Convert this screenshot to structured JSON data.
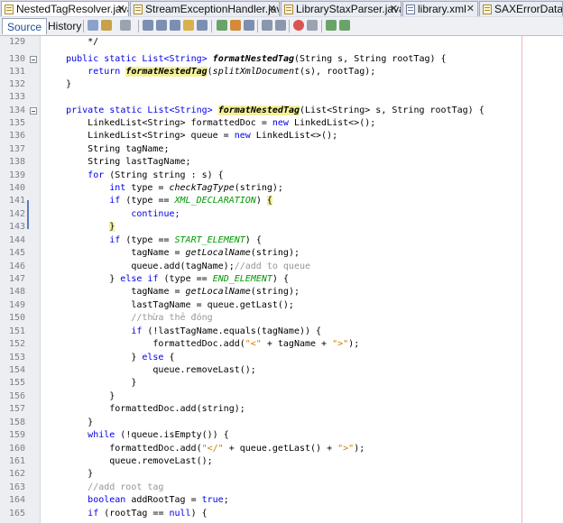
{
  "tabs": [
    {
      "label": "NestedTagResolver.java",
      "active": true
    },
    {
      "label": "StreamExceptionHandler.java",
      "active": false
    },
    {
      "label": "LibraryStaxParser.java",
      "active": false
    },
    {
      "label": "library.xml",
      "active": false
    },
    {
      "label": "SAXErrorDataPars",
      "active": false
    }
  ],
  "view_tabs": {
    "source": "Source",
    "history": "History"
  },
  "gutter": {
    "line_numbers": [
      "129",
      "130",
      "131",
      "132",
      "133",
      "134",
      "135",
      "136",
      "137",
      "138",
      "139",
      "140",
      "141",
      "142",
      "143",
      "144",
      "145",
      "146",
      "147",
      "148",
      "149",
      "150",
      "151",
      "152",
      "153",
      "154",
      "155",
      "156",
      "157",
      "158",
      "159",
      "160",
      "161",
      "162",
      "163",
      "164",
      "165"
    ]
  },
  "code": {
    "l129": "        */",
    "l130a": "    public static List<String> ",
    "l130m": "formatNestedTag",
    "l130b": "(String s, String rootTag) {",
    "l131a": "        return ",
    "l131m": "formatNestedTag",
    "l131b": "(",
    "l131c": "splitXmlDocument",
    "l131d": "(s), rootTag);",
    "l132": "    }",
    "l133": "",
    "l134a": "    private static List<String> ",
    "l134m": "formatNestedTag",
    "l134b": "(List<String> s, String rootTag) {",
    "l135": "        LinkedList<String> formattedDoc = new LinkedList<>();",
    "l136": "        LinkedList<String> queue = new LinkedList<>();",
    "l137": "        String tagName;",
    "l138": "        String lastTagName;",
    "l139": "        for (String string : s) {",
    "l140a": "            int type = ",
    "l140m": "checkTagType",
    "l140b": "(string);",
    "l141a": "            if (type == ",
    "l141c": "XML_DECLARATION",
    "l141b": ") ",
    "l141br": "{",
    "l142": "                continue;",
    "l143a": "            ",
    "l143br": "}",
    "l144a": "            if (type == ",
    "l144c": "START_ELEMENT",
    "l144b": ") {",
    "l145a": "                tagName = ",
    "l145m": "getLocalName",
    "l145b": "(string);",
    "l146a": "                queue.add(tagName);",
    "l146c": "//add to queue",
    "l147a": "            } else if (type == ",
    "l147c": "END_ELEMENT",
    "l147b": ") {",
    "l148a": "                tagName = ",
    "l148m": "getLocalName",
    "l148b": "(string);",
    "l149": "                lastTagName = queue.getLast();",
    "l150": "                //thừa thẻ đóng",
    "l151": "                if (!lastTagName.equals(tagName)) {",
    "l152a": "                    formattedDoc.add(",
    "l152s1": "\"<\"",
    "l152b": " + tagName + ",
    "l152s2": "\">\"",
    "l152c": ");",
    "l153": "                } else {",
    "l154": "                    queue.removeLast();",
    "l155": "                }",
    "l156": "            }",
    "l157": "            formattedDoc.add(string);",
    "l158": "        }",
    "l159": "        while (!queue.isEmpty()) {",
    "l160a": "            formattedDoc.add(",
    "l160s1": "\"</\"",
    "l160b": " + queue.getLast() + ",
    "l160s2": "\">\"",
    "l160c": ");",
    "l161": "            queue.removeLast();",
    "l162": "        }",
    "l163": "        //add root tag",
    "l164": "        boolean addRootTag = true;",
    "l165": "        if (rootTag == null) {"
  },
  "colors": {
    "keyword": "#0000e6",
    "constant": "#009900",
    "string": "#ce7b00",
    "comment": "#969696",
    "highlight": "#f4f19a"
  }
}
